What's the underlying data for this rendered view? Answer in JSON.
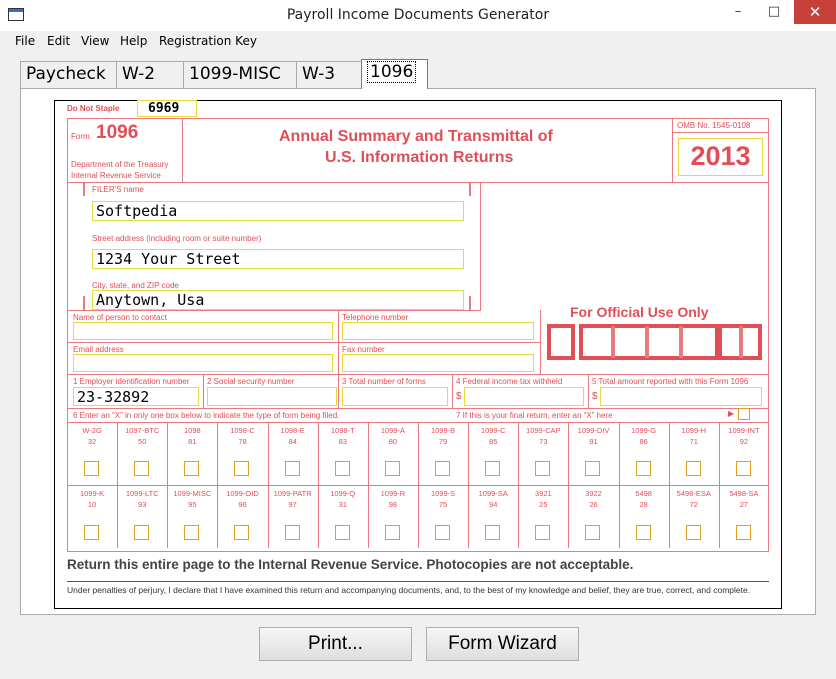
{
  "window": {
    "title": "Payroll Income Documents Generator",
    "minimize": "–",
    "maximize": "□",
    "close": "✕"
  },
  "menu": [
    "File",
    "Edit",
    "View",
    "Help",
    "Registration Key"
  ],
  "tabs": [
    "Paycheck",
    "W-2",
    "1099-MISC",
    "W-3",
    "1096"
  ],
  "form": {
    "do_not_staple": "Do Not Staple",
    "staple_code": "6969",
    "form_word": "Form",
    "form_number": "1096",
    "dept_line1": "Department of the Treasury",
    "dept_line2": "Internal Revenue Service",
    "title_line1": "Annual Summary and Transmittal of",
    "title_line2": "U.S. Information Returns",
    "omb": "OMB No. 1545-0108",
    "year": "2013",
    "filer_name_label": "FILER'S name",
    "filer_name": "Softpedia",
    "street_label": "Street address (including room or suite number)",
    "street": "1234 Your Street",
    "city_label": "City, state, and ZIP code",
    "city": "Anytown, Usa",
    "official_use": "For Official Use Only",
    "contact_label": "Name of person to contact",
    "phone_label": "Telephone number",
    "email_label": "Email address",
    "fax_label": "Fax number",
    "box1_label": "1 Employer identification number",
    "box1_value": "23-32892",
    "box2_label": "2 Social security number",
    "box3_label": "3 Total number of forms",
    "box4_label": "4 Federal income tax withheld",
    "box5_label": "5 Total amount reported with this Form 1096",
    "dollar": "$",
    "box6_label": "6 Enter an “X” in only one box below to indicate the type of form being filed.",
    "box7_label": "7 If this is your final return, enter an “X” here",
    "box7_arrow": "▶",
    "types_row1": [
      {
        "name": "W-2G",
        "code": "32"
      },
      {
        "name": "1097-BTC",
        "code": "50"
      },
      {
        "name": "1098",
        "code": "81"
      },
      {
        "name": "1098-C",
        "code": "78"
      },
      {
        "name": "1098-E",
        "code": "84"
      },
      {
        "name": "1098-T",
        "code": "83"
      },
      {
        "name": "1099-A",
        "code": "80"
      },
      {
        "name": "1099-B",
        "code": "79"
      },
      {
        "name": "1099-C",
        "code": "85"
      },
      {
        "name": "1099-CAP",
        "code": "73"
      },
      {
        "name": "1099-DIV",
        "code": "91"
      },
      {
        "name": "1099-G",
        "code": "86"
      },
      {
        "name": "1099-H",
        "code": "71"
      },
      {
        "name": "1099-INT",
        "code": "92"
      }
    ],
    "types_row2": [
      {
        "name": "1099-K",
        "code": "10"
      },
      {
        "name": "1099-LTC",
        "code": "93"
      },
      {
        "name": "1099-MISC",
        "code": "95"
      },
      {
        "name": "1099-OID",
        "code": "96"
      },
      {
        "name": "1099-PATR",
        "code": "97"
      },
      {
        "name": "1099-Q",
        "code": "31"
      },
      {
        "name": "1099-R",
        "code": "98"
      },
      {
        "name": "1099-S",
        "code": "75"
      },
      {
        "name": "1099-SA",
        "code": "94"
      },
      {
        "name": "3921",
        "code": "25"
      },
      {
        "name": "3922",
        "code": "26"
      },
      {
        "name": "5498",
        "code": "28"
      },
      {
        "name": "5498-ESA",
        "code": "72"
      },
      {
        "name": "5498-SA",
        "code": "27"
      }
    ],
    "return_note": "Return this entire page to the Internal Revenue Service. Photocopies are not acceptable.",
    "penalty_text": "Under penalties of perjury, I declare that I have examined this return and accompanying documents, and, to the best of my knowledge and belief, they are true, correct, and complete."
  },
  "buttons": {
    "print": "Print...",
    "wizard": "Form Wizard"
  },
  "colors": {
    "form_red": "#e04e57",
    "field_yellow": "#e8d93c",
    "checkbox_orange": "#e0a020",
    "close_red": "#c7403a"
  }
}
